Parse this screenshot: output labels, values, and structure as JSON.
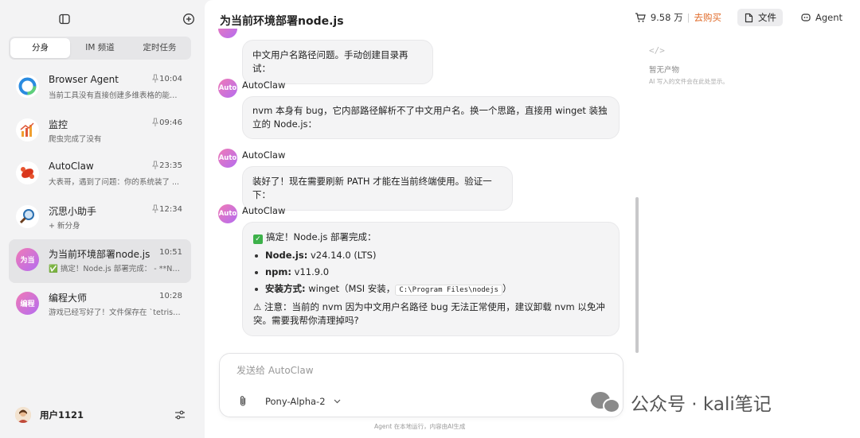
{
  "sidebar": {
    "tabs": [
      {
        "label": "分身",
        "active": true
      },
      {
        "label": "IM 频道",
        "active": false
      },
      {
        "label": "定时任务",
        "active": false
      }
    ],
    "conversations": [
      {
        "title": "Browser Agent",
        "time": "10:04",
        "pinned": true,
        "preview": "当前工具没有直接创建多维表格的能力…",
        "avatar_icon": "browser-agent-ring-icon"
      },
      {
        "title": "监控",
        "time": "09:46",
        "pinned": true,
        "preview": "爬虫完成了没有",
        "avatar_icon": "chart-icon"
      },
      {
        "title": "AutoClaw",
        "time": "23:35",
        "pinned": true,
        "preview": "大表哥，遇到了问题：你的系统装了 ...",
        "avatar_icon": "lobster-icon"
      },
      {
        "title": "沉思小助手",
        "time": "12:34",
        "pinned": true,
        "preview": "+ 新分身",
        "avatar_icon": "magnifier-icon"
      },
      {
        "title": "为当前环境部署node.js",
        "time": "10:51",
        "pinned": false,
        "preview": "✅ 搞定！Node.js 部署完成： - **No...",
        "avatar_text": "为当",
        "active": true
      },
      {
        "title": "编程大师",
        "time": "10:28",
        "pinned": false,
        "preview": "游戏已经写好了！文件保存在 `tetris.html`",
        "avatar_text": "编程"
      }
    ],
    "user": {
      "name": "用户1121"
    }
  },
  "header": {
    "title": "为当前环境部署node.js",
    "balance": "9.58 万",
    "buy_label": "去购买",
    "file_label": "文件",
    "agent_label": "Agent"
  },
  "artifacts": {
    "icon_text": "</>",
    "empty_text": "暂无产物",
    "hint_text": "AI 写入的文件会在此处显示。"
  },
  "messages": [
    {
      "text": "中文用户名路径问题。手动创建目录再试："
    },
    {
      "sender": "AutoClaw",
      "avatar_text": "Auto",
      "text": "nvm 本身有 bug，它内部路径解析不了中文用户名。换一个思路，直接用 winget 装独立的 Node.js："
    },
    {
      "sender": "AutoClaw",
      "avatar_text": "Auto",
      "text": "装好了！现在需要刷新 PATH 才能在当前终端使用。验证一下："
    },
    {
      "sender": "AutoClaw",
      "avatar_text": "Auto",
      "intro": "搞定！Node.js 部署完成：",
      "items": [
        {
          "key": "Node.js:",
          "value": " v24.14.0 (LTS)"
        },
        {
          "key": "npm:",
          "value": " v11.9.0"
        },
        {
          "key": "安装方式:",
          "value": " winget（MSI 安装，",
          "code": "C:\\Program Files\\nodejs",
          "tail": "）"
        }
      ],
      "note": "⚠ 注意：当前的 nvm 因为中文用户名路径 bug 无法正常使用，建议卸载 nvm 以免冲突。需要我帮你清理掉吗?"
    }
  ],
  "composer": {
    "placeholder": "发送给 AutoClaw",
    "model": "Pony-Alpha-2"
  },
  "footer_note": "Agent 在本地运行，内容由AI生成",
  "watermark": "公众号 · kali笔记"
}
